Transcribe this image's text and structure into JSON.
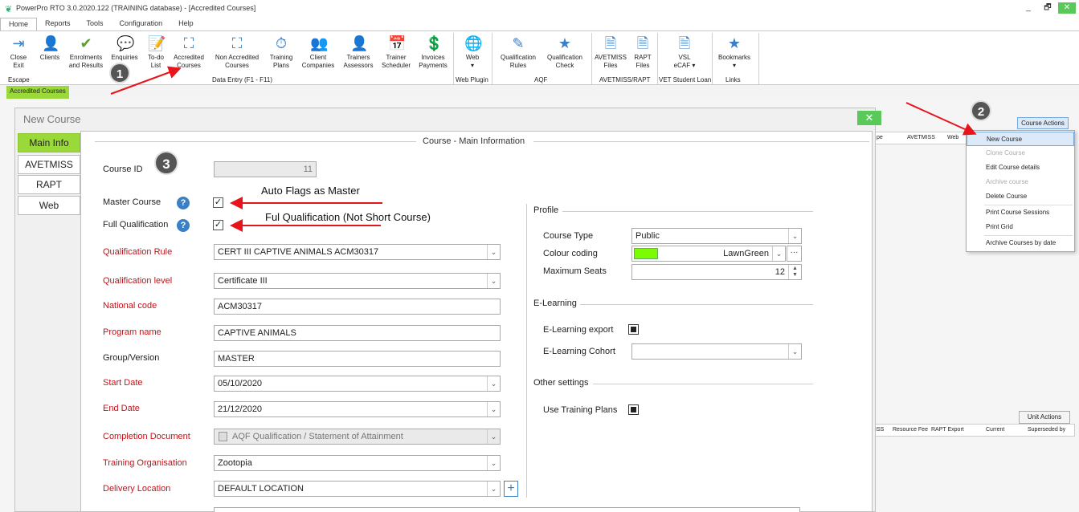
{
  "window": {
    "title": "PowerPro RTO 3.0.2020.122 (TRAINING database) - [Accredited Courses]",
    "controls": [
      "_",
      "🗗",
      "✕"
    ]
  },
  "menu_tabs": [
    "Home",
    "Reports",
    "Tools",
    "Configuration",
    "Help"
  ],
  "ribbon": {
    "buttons": [
      {
        "label": "Close\nExit",
        "icon": "exit-icon"
      },
      {
        "label": "Clients",
        "icon": "person-icon"
      },
      {
        "label": "Enrolments\nand Results",
        "icon": "check-icon"
      },
      {
        "label": "Enquiries",
        "icon": "chat-icon"
      },
      {
        "label": "To-do\nList",
        "icon": "note-icon"
      },
      {
        "label": "Accredited\nCourses",
        "icon": "hierarchy-icon"
      },
      {
        "label": "Non Accredited\nCourses",
        "icon": "hierarchy-icon"
      },
      {
        "label": "Training\nPlans",
        "icon": "timeline-icon"
      },
      {
        "label": "Client\nCompanies",
        "icon": "group-icon"
      },
      {
        "label": "Trainers\nAssessors",
        "icon": "person-icon"
      },
      {
        "label": "Trainer\nScheduler",
        "icon": "calendar-icon"
      },
      {
        "label": "Invoices\nPayments",
        "icon": "money-icon"
      },
      {
        "label": "Web\n▾",
        "icon": "globe-icon"
      },
      {
        "label": "Qualification\nRules",
        "icon": "pen-icon"
      },
      {
        "label": "Qualification\nCheck",
        "icon": "star-icon"
      },
      {
        "label": "AVETMISS\nFiles",
        "icon": "files-icon"
      },
      {
        "label": "RAPT\nFiles",
        "icon": "files-icon"
      },
      {
        "label": "VSL\neCAF ▾",
        "icon": "files-icon"
      },
      {
        "label": "Bookmarks\n▾",
        "icon": "star-icon"
      }
    ],
    "groups": [
      "Escape",
      "Data Entry (F1 - F11)",
      "Web Plugin",
      "AQF",
      "AVETMISS/RAPT",
      "VET Student Loan",
      "Links"
    ]
  },
  "module_tab": "Accredited Courses",
  "background_grid": {
    "headers_top": [
      "pe",
      "AVETMISS",
      "Web"
    ],
    "headers_bottom": [
      "ISS",
      "Resource Fee",
      "RAPT Export",
      "Current",
      "Superseded by"
    ],
    "course_actions": "Course Actions",
    "unit_actions": "Unit Actions"
  },
  "context_menu": {
    "items": [
      {
        "label": "New Course",
        "state": "highlighted"
      },
      {
        "label": "Clone Course",
        "state": "disabled"
      },
      {
        "label": "Edit Course details",
        "state": "normal"
      },
      {
        "label": "Archive course",
        "state": "disabled"
      },
      {
        "label": "Delete Course",
        "state": "normal"
      },
      {
        "label": "Print Course Sessions",
        "state": "normal"
      },
      {
        "label": "Print Grid",
        "state": "normal"
      },
      {
        "label": "Archive Courses by date",
        "state": "normal"
      }
    ]
  },
  "dialog": {
    "title": "New Course",
    "close": "✕",
    "side_tabs": [
      "Main Info",
      "AVETMISS",
      "RAPT",
      "Web"
    ],
    "section_title": "Course - Main Information",
    "fields": {
      "course_id": {
        "label": "Course ID",
        "value": "11"
      },
      "master_course": {
        "label": "Master Course",
        "checked": true
      },
      "full_qualification": {
        "label": "Full Qualification",
        "checked": true
      },
      "qualification_rule": {
        "label": "Qualification Rule",
        "value": "CERT III CAPTIVE ANIMALS ACM30317"
      },
      "qualification_level": {
        "label": "Qualification level",
        "value": "Certificate III"
      },
      "national_code": {
        "label": "National code",
        "value": "ACM30317"
      },
      "program_name": {
        "label": "Program name",
        "value": "CAPTIVE ANIMALS"
      },
      "group_version": {
        "label": "Group/Version",
        "value": "MASTER"
      },
      "start_date": {
        "label": "Start Date",
        "value": "05/10/2020"
      },
      "end_date": {
        "label": "End Date",
        "value": "21/12/2020"
      },
      "completion_document": {
        "label": "Completion Document",
        "value": "AQF Qualification / Statement of Attainment"
      },
      "training_organisation": {
        "label": "Training Organisation",
        "value": "Zootopia"
      },
      "delivery_location": {
        "label": "Delivery Location",
        "value": "DEFAULT LOCATION"
      }
    },
    "profile": {
      "heading": "Profile",
      "course_type": {
        "label": "Course Type",
        "value": "Public"
      },
      "colour_coding": {
        "label": "Colour coding",
        "value": "LawnGreen",
        "swatch": "#7CFC00"
      },
      "maximum_seats": {
        "label": "Maximum Seats",
        "value": "12"
      }
    },
    "elearning": {
      "heading": "E-Learning",
      "export": {
        "label": "E-Learning export",
        "checked": false
      },
      "cohort": {
        "label": "E-Learning Cohort",
        "value": ""
      }
    },
    "other": {
      "heading": "Other settings",
      "use_training_plans": {
        "label": "Use Training Plans",
        "checked": false
      }
    }
  },
  "annotations": {
    "badge1": "1",
    "badge2": "2",
    "badge3": "3",
    "note_master": "Auto Flags as Master",
    "note_full": "Ful Qualification (Not Short Course)",
    "arrow_color": "#e8141b"
  }
}
